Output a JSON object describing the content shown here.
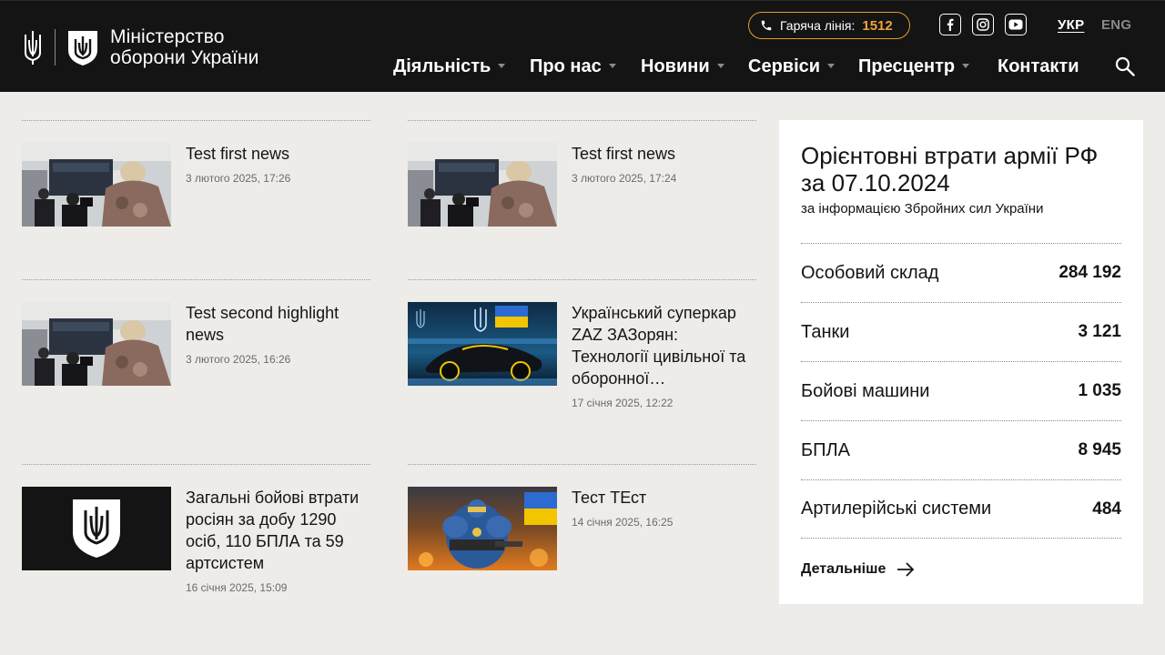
{
  "header": {
    "logo_line1": "Міністерство",
    "logo_line2": "оборони України",
    "hotline_label": "Гаряча лінія:",
    "hotline_number": "1512",
    "social": [
      "facebook-icon",
      "instagram-icon",
      "youtube-icon"
    ],
    "lang_active": "УКР",
    "lang_inactive": "ENG",
    "nav": {
      "activity": "Діяльність",
      "about": "Про нас",
      "news": "Новини",
      "services": "Сервіси",
      "press": "Пресцентр",
      "contacts": "Контакти"
    },
    "colors": {
      "bg": "#141414",
      "accent": "#f0a23a"
    }
  },
  "news": [
    {
      "title": "Test first news",
      "date": "3 лютого 2025, 17:26"
    },
    {
      "title": "Test first news",
      "date": "3 лютого 2025, 17:24"
    },
    {
      "title": "Test second highlight news",
      "date": "3 лютого 2025, 16:26"
    },
    {
      "title": "Український суперкар ZAZ ЗАЗорян: Технології цивільної та оборонної…",
      "date": "17 січня 2025, 12:22"
    },
    {
      "title": "Загальні бойові втрати росіян за добу 1290 осіб, 110 БПЛА та 59 артсистем",
      "date": "16 січня 2025, 15:09"
    },
    {
      "title": "Тест ТЕст",
      "date": "14 січня 2025, 16:25"
    }
  ],
  "losses": {
    "title": "Орієнтовні втрати армії РФ за 07.10.2024",
    "subtitle": "за інформацією Збройних сил України",
    "rows": [
      {
        "label": "Особовий склад",
        "value": "284 192"
      },
      {
        "label": "Танки",
        "value": "3 121"
      },
      {
        "label": "Бойові машини",
        "value": "1 035"
      },
      {
        "label": "БПЛА",
        "value": "8 945"
      },
      {
        "label": "Артилерійські системи",
        "value": "484"
      }
    ],
    "more": "Детальніше"
  }
}
